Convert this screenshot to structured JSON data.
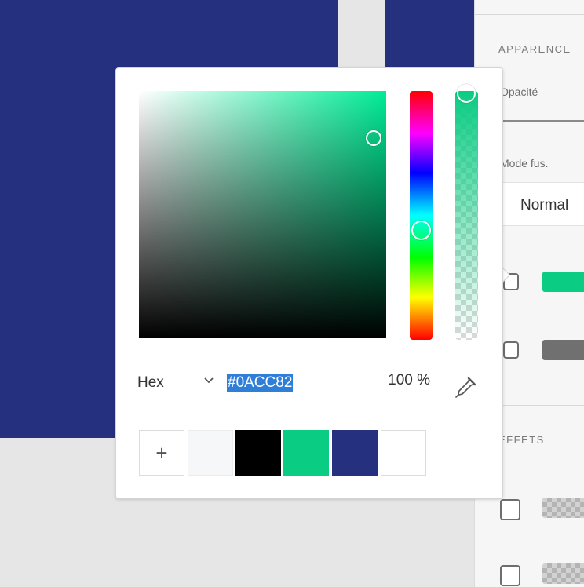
{
  "panel": {
    "appearance_title": "APPARENCE",
    "opacity_label": "Opacité",
    "blend_label": "Mode fus.",
    "blend_value": "Normal",
    "fill_color": "#0ACC82",
    "border_color": "#707070",
    "effects_title": "EFFETS"
  },
  "picker": {
    "mode": "Hex",
    "hex_value": "#0ACC82",
    "opacity": "100 %",
    "add_symbol": "+",
    "hue_value": "156",
    "swatches": [
      "#F6F7F9",
      "#000000",
      "#0ACC82",
      "#25307F",
      "#FFFFFF"
    ]
  },
  "canvas": {
    "artboard_color": "#25307F"
  }
}
